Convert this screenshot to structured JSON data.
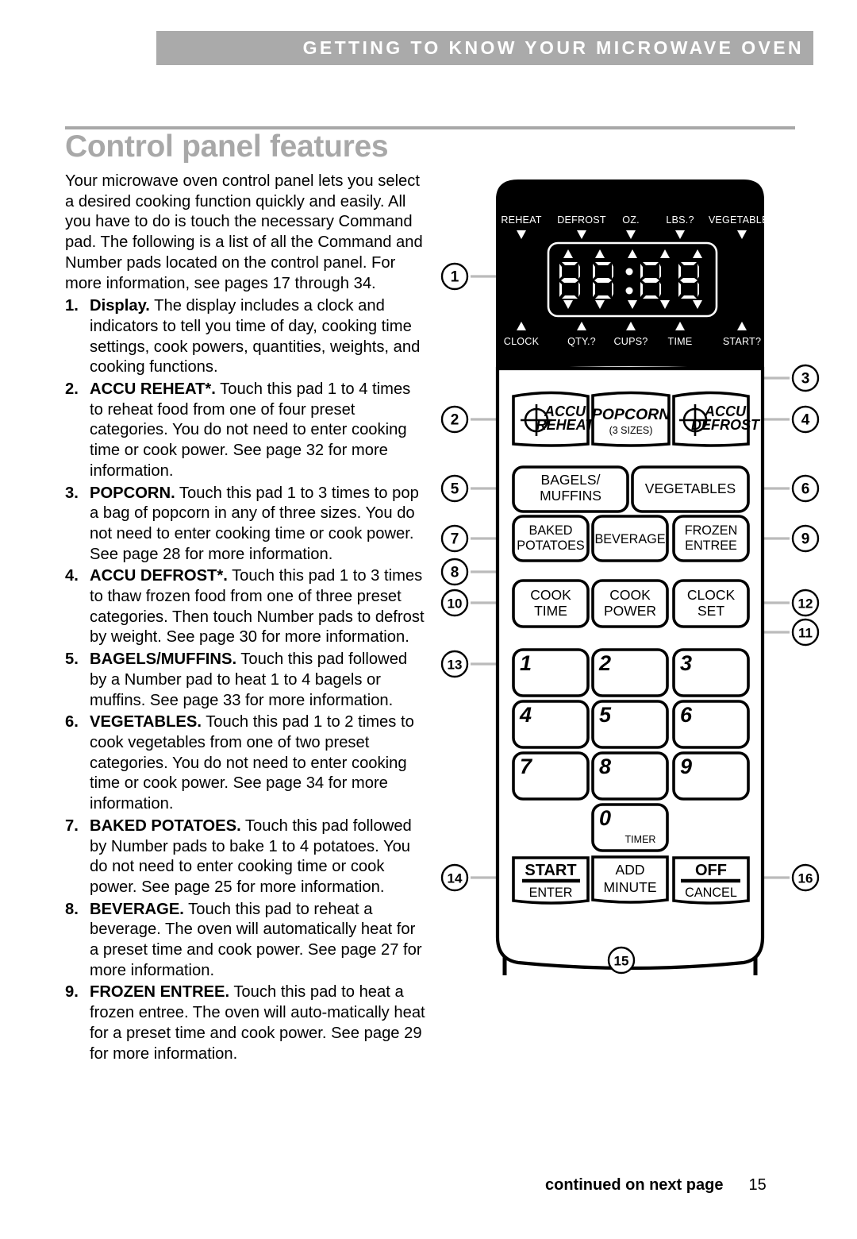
{
  "header": {
    "running_head": "GETTING TO KNOW YOUR MICROWAVE OVEN"
  },
  "title": "Control panel features",
  "intro": "Your microwave oven control panel lets you select a desired cooking function quickly and easily. All you have to do is touch the necessary Command pad. The following is a list of all the Command and Number pads located on the control panel. For more information, see pages 17 through 34.",
  "items": [
    {
      "num": "1.",
      "term": "Display.",
      "text": " The display includes a clock and indicators to tell you time of day, cooking time settings, cook powers, quantities, weights, and cooking functions."
    },
    {
      "num": "2.",
      "term": "ACCU REHEAT*.",
      "text": " Touch this pad 1 to 4 times to reheat food from one of four preset categories. You do not need to enter cooking time or cook power. See page 32 for more information."
    },
    {
      "num": "3.",
      "term": "POPCORN.",
      "text": " Touch this pad 1 to 3 times to pop a bag of popcorn in any of three sizes. You do not need to enter cooking time or cook power. See page 28 for more information."
    },
    {
      "num": "4.",
      "term": "ACCU DEFROST*.",
      "text": " Touch this pad 1 to 3 times to thaw frozen food from one of three preset categories. Then touch Number pads to defrost by weight. See page 30 for more information."
    },
    {
      "num": "5.",
      "term": "BAGELS/MUFFINS.",
      "text": " Touch this pad followed by a Number pad to heat 1 to 4 bagels or muffins. See page 33 for more information."
    },
    {
      "num": "6.",
      "term": "VEGETABLES.",
      "text": " Touch this pad 1 to 2 times to cook vegetables from one of two preset categories. You do not need to enter cooking time or cook power. See page 34 for more information."
    },
    {
      "num": "7.",
      "term": "BAKED POTATOES.",
      "text": " Touch this pad followed by Number pads to bake 1 to 4 potatoes. You do not need to enter cooking time or cook power. See page 25 for more information."
    },
    {
      "num": "8.",
      "term": "BEVERAGE.",
      "text": " Touch this pad to reheat a beverage. The oven will automatically heat for a preset time and cook power. See page 27 for more information."
    },
    {
      "num": "9.",
      "term": "FROZEN ENTREE.",
      "text": " Touch this pad to heat a frozen entree. The oven will auto-matically heat for a preset time and cook power. See page 29 for more information."
    }
  ],
  "footer": {
    "continued": "continued on next page",
    "page_number": "15"
  },
  "diagram": {
    "display": {
      "digits": "88:88",
      "indicators_top": [
        "REHEAT",
        "DEFROST",
        "OZ.",
        "LBS.?",
        "VEGETABLES"
      ],
      "indicators_bottom": [
        "CLOCK",
        "QTY.?",
        "CUPS?",
        "TIME",
        "START?"
      ]
    },
    "buttons": {
      "accu_reheat_l1": "ACCU",
      "accu_reheat_l2": "REHEAT",
      "popcorn": "POPCORN",
      "popcorn_sub": "(3 SIZES)",
      "accu_defrost_l1": "ACCU",
      "accu_defrost_l2": "DEFROST",
      "bagels_l1": "BAGELS/",
      "bagels_l2": "MUFFINS",
      "vegetables": "VEGETABLES",
      "baked_l1": "BAKED",
      "baked_l2": "POTATOES",
      "beverage": "BEVERAGE",
      "frozen_l1": "FROZEN",
      "frozen_l2": "ENTREE",
      "cooktime_l1": "COOK",
      "cooktime_l2": "TIME",
      "cookpower_l1": "COOK",
      "cookpower_l2": "POWER",
      "clockset_l1": "CLOCK",
      "clockset_l2": "SET",
      "start": "START",
      "enter": "ENTER",
      "add_l1": "ADD",
      "add_l2": "MINUTE",
      "off": "OFF",
      "cancel": "CANCEL",
      "timer": "TIMER"
    },
    "number_pads": [
      "1",
      "2",
      "3",
      "4",
      "5",
      "6",
      "7",
      "8",
      "9",
      "0"
    ],
    "callouts": [
      "1",
      "2",
      "3",
      "4",
      "5",
      "6",
      "7",
      "8",
      "9",
      "10",
      "11",
      "12",
      "13",
      "14",
      "15",
      "16"
    ]
  }
}
